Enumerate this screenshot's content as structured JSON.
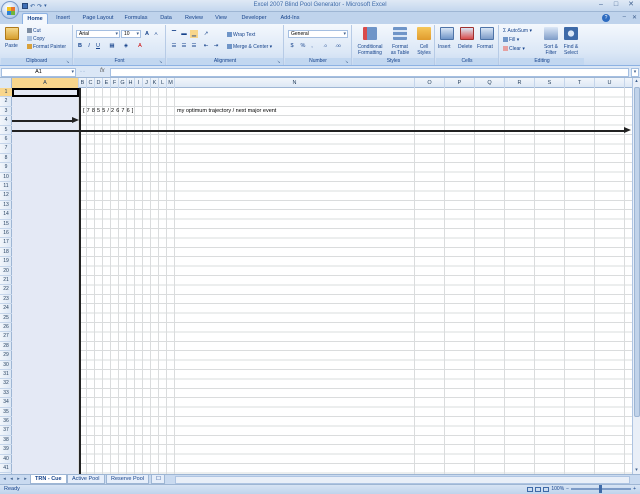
{
  "window": {
    "title": "Excel 2007 Blind Pool Generator - Microsoft Excel"
  },
  "tabs": [
    "Home",
    "Insert",
    "Page Layout",
    "Formulas",
    "Data",
    "Review",
    "View",
    "Developer",
    "Add-Ins"
  ],
  "active_tab": "Home",
  "ribbon": {
    "clipboard": {
      "label": "Clipboard",
      "paste": "Paste",
      "cut": "Cut",
      "copy": "Copy",
      "format_painter": "Format Painter"
    },
    "font": {
      "label": "Font",
      "font_name": "Arial",
      "font_size": "10",
      "bold": "B",
      "italic": "I",
      "underline": "U",
      "grow": "A",
      "shrink": "A"
    },
    "alignment": {
      "label": "Alignment",
      "wrap_text": "Wrap Text",
      "merge_center": "Merge & Center"
    },
    "number": {
      "label": "Number",
      "format": "General",
      "currency": "$",
      "percent": "%",
      "comma": ",",
      "inc_decimal": ".0",
      "dec_decimal": ".00"
    },
    "styles": {
      "label": "Styles",
      "conditional": "Conditional",
      "conditional2": "Formatting",
      "format_table": "Format",
      "format_table2": "as Table",
      "cell_styles": "Cell",
      "cell_styles2": "Styles"
    },
    "cells": {
      "label": "Cells",
      "insert": "Insert",
      "delete": "Delete",
      "format": "Format"
    },
    "editing": {
      "label": "Editing",
      "autosum": "AutoSum",
      "fill": "Fill",
      "clear": "Clear",
      "sort": "Sort &",
      "sort2": "Filter",
      "find": "Find &",
      "find2": "Select"
    }
  },
  "formula_bar": {
    "name_box": "A1",
    "fx": "fx",
    "formula": ""
  },
  "columns": [
    "A",
    "B",
    "C",
    "D",
    "E",
    "F",
    "G",
    "H",
    "I",
    "J",
    "K",
    "L",
    "M",
    "N",
    "O",
    "P",
    "Q",
    "R",
    "S",
    "T",
    "U"
  ],
  "row_count": 41,
  "cells": {
    "row3_digits": "[  7  8  5  5  /  2  6  7  6  ]",
    "row3_note": "my optimum trajectory / next major event"
  },
  "sheet_tabs": [
    "TRN - Cue",
    "Active Pool",
    "Reserve Pool"
  ],
  "active_sheet": "TRN - Cue",
  "status": {
    "text": "Ready",
    "zoom": "100%",
    "zoom_minus": "−",
    "zoom_plus": "+"
  }
}
